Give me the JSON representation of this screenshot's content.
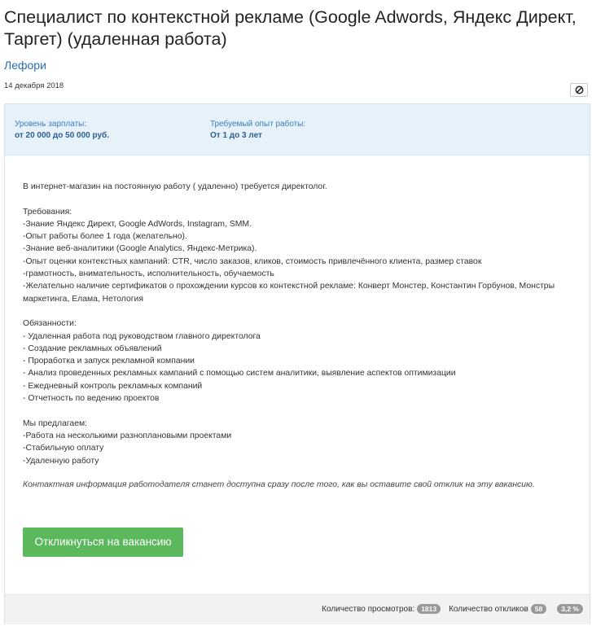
{
  "vacancy": {
    "title": "Специалист по контекстной рекламе (Google Adwords, Яндекс Директ, Таргет) (удаленная работа)",
    "company": "Лефори",
    "date": "14 декабря 2018"
  },
  "summary": {
    "salary_label": "Уровень зарплаты:",
    "salary_value": "от 20 000 до 50 000 руб.",
    "experience_label": "Требуемый опыт работы:",
    "experience_value": "От 1 до 3 лет"
  },
  "description": {
    "intro": "В интернет-магазин на постоянную работу ( удаленно) требуется директолог.",
    "requirements_title": "Требования:",
    "requirements": [
      "-Знание Яндекс Директ, Google AdWords, Instagram, SMM.",
      "-Опыт работы более 1 года (желательно).",
      "-Знание веб-аналитики (Google Analytics, Яндекс-Метрика).",
      "-Опыт оценки контекстных кампаний: CTR, число заказов, кликов, стоимость привлечённого клиента, размер ставок",
      "-грамотность, внимательность, исполнительность, обучаемость",
      "-Желательно наличие сертификатов о прохождении курсов ко контекстной рекламе: Конверт Монстер, Константин Горбунов, Монстры маркетинга, Елама, Нетология"
    ],
    "duties_title": "Обязанности:",
    "duties": [
      "- Удаленная работа под руководством главного директолога",
      "- Создание рекламных объявлений",
      "- Проработка и запуск рекламной компании",
      "- Анализ проведенных рекламных кампаний с помощью систем аналитики, выявление аспектов оптимизации",
      "- Ежедневный контроль рекламных компаний",
      "- Отчетность по ведению проектов"
    ],
    "offer_title": "Мы предлагаем:",
    "offer": [
      "-Работа на несколькими разноплановыми проектами",
      "-Стабильную оплату",
      "-Удаленную работу"
    ],
    "contact_note": "Контактная информация работодателя станет доступна сразу после того, как вы оставите свой отклик на эту вакансию."
  },
  "actions": {
    "apply_label": "Откликнуться на вакансию",
    "hide_icon": "block-icon"
  },
  "stats": {
    "views_label": "Количество просмотров:",
    "views_count": "1813",
    "responses_label": "Количество откликов",
    "responses_count": "58",
    "response_rate": "3,2 %"
  },
  "colors": {
    "link": "#2a6fb0",
    "header_bg": "#e6f1f9",
    "apply_button": "#5cb85c",
    "badge": "#999999"
  }
}
